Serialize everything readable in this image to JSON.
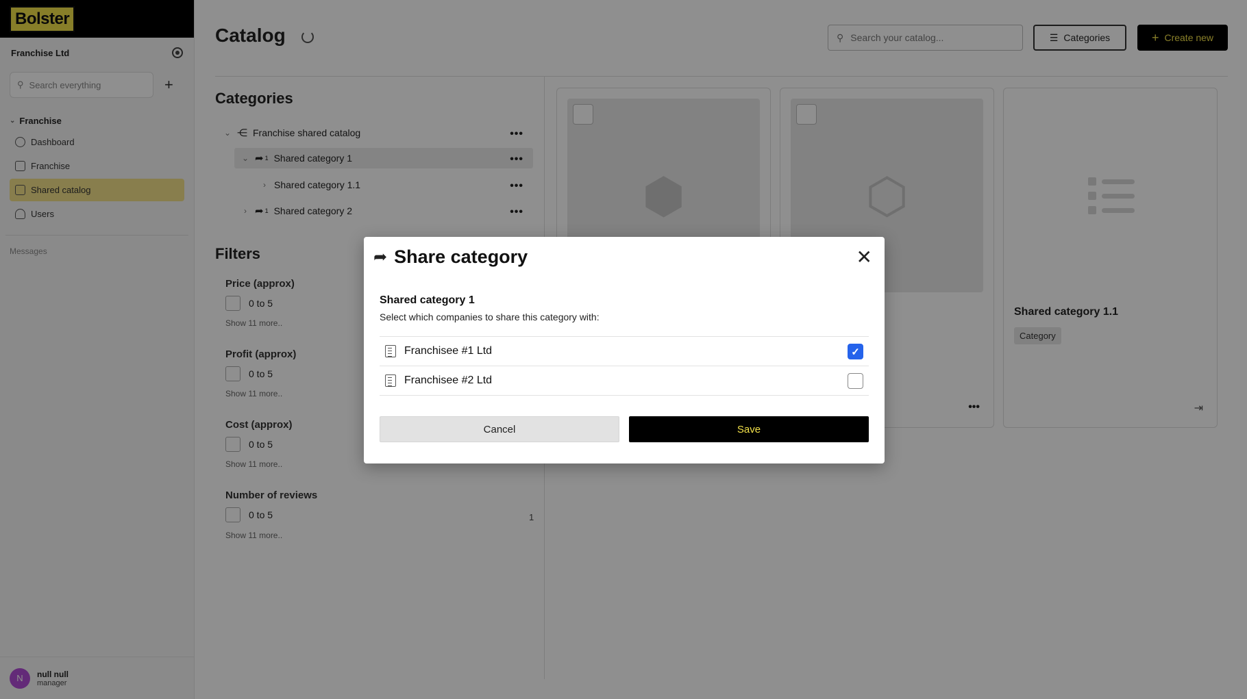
{
  "sidebar": {
    "logo": "Bolster",
    "company": "Franchise Ltd",
    "search_placeholder": "Search everything",
    "section_title": "Franchise",
    "items": [
      {
        "label": "Dashboard",
        "icon": "dashboard-icon",
        "active": false
      },
      {
        "label": "Franchise",
        "icon": "building-icon",
        "active": false
      },
      {
        "label": "Shared catalog",
        "icon": "catalog-icon",
        "active": true
      },
      {
        "label": "Users",
        "icon": "users-icon",
        "active": false
      }
    ],
    "messages_label": "Messages",
    "user": {
      "initial": "N",
      "name": "null null",
      "role": "manager"
    }
  },
  "header": {
    "title": "Catalog",
    "search_placeholder": "Search your catalog...",
    "categories_button": "Categories",
    "create_button": "Create new"
  },
  "categories_panel": {
    "title": "Categories",
    "tree": [
      {
        "label": "Franchise shared catalog",
        "expanded": true
      },
      {
        "label": "Shared category 1",
        "badge": "1",
        "expanded": true,
        "highlighted": true
      },
      {
        "label": "Shared category 1.1",
        "expanded": false
      },
      {
        "label": "Shared category 2",
        "badge": "1",
        "expanded": false
      }
    ]
  },
  "filters": {
    "title": "Filters",
    "groups": [
      {
        "label": "Price (approx)",
        "option": "0 to 5",
        "show_more": "Show 11 more.."
      },
      {
        "label": "Profit (approx)",
        "option": "0 to 5",
        "show_more": "Show 11 more.."
      },
      {
        "label": "Cost (approx)",
        "option": "0 to 5",
        "show_more": "Show 11 more.."
      },
      {
        "label": "Number of reviews",
        "option": "0 to 5",
        "show_more": "Show 11 more..",
        "count": "1"
      }
    ]
  },
  "cards": [
    {
      "icon": "cubes-icon"
    },
    {
      "icon": "box-icon"
    },
    {
      "icon": "list-icon",
      "title": "Shared category 1.1",
      "badge": "Category"
    }
  ],
  "modal": {
    "title": "Share category",
    "subtitle": "Shared category 1",
    "description": "Select which companies to share this category with:",
    "companies": [
      {
        "name": "Franchisee #1 Ltd",
        "checked": true
      },
      {
        "name": "Franchisee #2 Ltd",
        "checked": false
      }
    ],
    "cancel_label": "Cancel",
    "save_label": "Save"
  },
  "colors": {
    "accent_yellow": "#f1e04a",
    "checkbox_blue": "#2563eb",
    "overlay": "rgba(0,0,0,0.44)"
  }
}
